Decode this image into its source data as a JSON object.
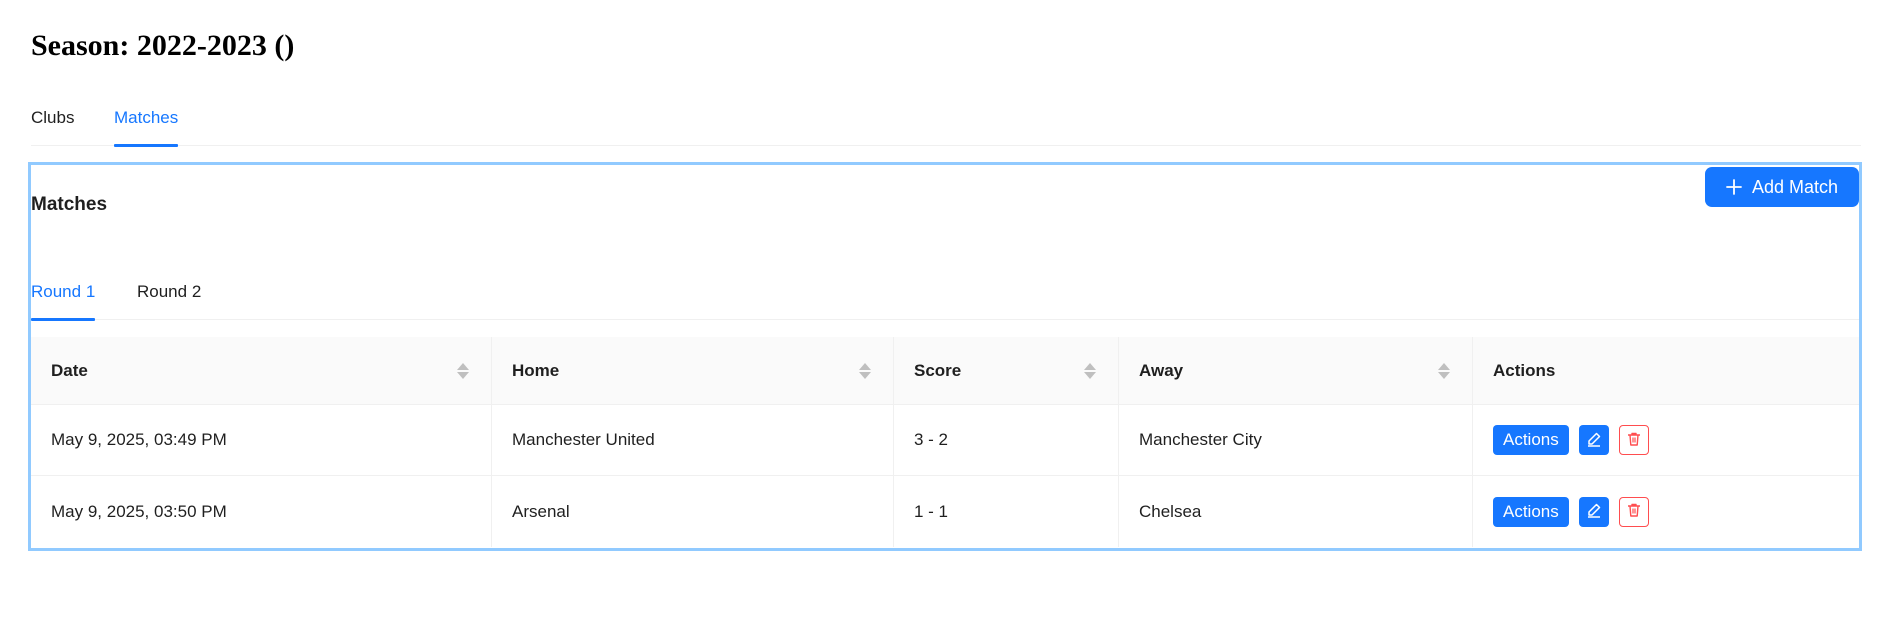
{
  "season": {
    "title": "Season: 2022-2023 ()"
  },
  "top_tabs": [
    {
      "label": "Clubs",
      "active": false
    },
    {
      "label": "Matches",
      "active": true
    }
  ],
  "panel": {
    "title": "Matches",
    "add_button_label": "Add Match",
    "add_button_icon": "plus-icon"
  },
  "round_tabs": [
    {
      "label": "Round 1",
      "active": true
    },
    {
      "label": "Round 2",
      "active": false
    }
  ],
  "table": {
    "columns": [
      {
        "label": "Date",
        "sortable": true
      },
      {
        "label": "Home",
        "sortable": true
      },
      {
        "label": "Score",
        "sortable": true
      },
      {
        "label": "Away",
        "sortable": true
      },
      {
        "label": "Actions",
        "sortable": false
      }
    ],
    "rows": [
      {
        "date": "May 9, 2025, 03:49 PM",
        "home": "Manchester United",
        "score": "3 - 2",
        "away": "Manchester City",
        "actions_label": "Actions"
      },
      {
        "date": "May 9, 2025, 03:50 PM",
        "home": "Arsenal",
        "score": "1 - 1",
        "away": "Chelsea",
        "actions_label": "Actions"
      }
    ]
  },
  "colors": {
    "primary": "#1677ff",
    "danger": "#ff4d4f",
    "highlight_border": "#91caff",
    "header_bg": "#fafafa"
  }
}
